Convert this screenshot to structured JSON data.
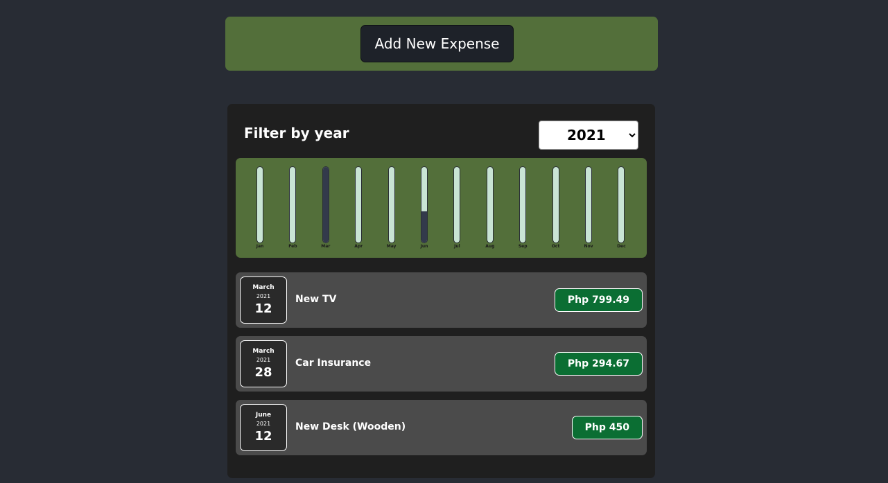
{
  "new_expense": {
    "add_button_label": "Add New Expense"
  },
  "filter": {
    "label": "Filter by year",
    "selected_year": "2021",
    "options": [
      "2021"
    ]
  },
  "chart_data": {
    "type": "bar",
    "categories": [
      "Jan",
      "Feb",
      "Mar",
      "Apr",
      "May",
      "Jun",
      "Jul",
      "Aug",
      "Sep",
      "Oct",
      "Nov",
      "Dec"
    ],
    "values": [
      0,
      0,
      1094.16,
      0,
      0,
      450,
      0,
      0,
      0,
      0,
      0,
      0
    ],
    "ylim": [
      0,
      1094.16
    ]
  },
  "expenses": [
    {
      "month": "March",
      "year": "2021",
      "day": "12",
      "title": "New TV",
      "amount": "Php 799.49"
    },
    {
      "month": "March",
      "year": "2021",
      "day": "28",
      "title": "Car Insurance",
      "amount": "Php 294.67"
    },
    {
      "month": "June",
      "year": "2021",
      "day": "12",
      "title": "New Desk (Wooden)",
      "amount": "Php 450"
    }
  ],
  "colors": {
    "page_background": "#282c34",
    "panel_green": "#536f3a",
    "card_background": "#1f1f1f",
    "item_background": "#4b4b4b",
    "price_green": "#0b6e33",
    "bar_track": "#c9e4d4",
    "bar_fill": "#333a4b"
  }
}
